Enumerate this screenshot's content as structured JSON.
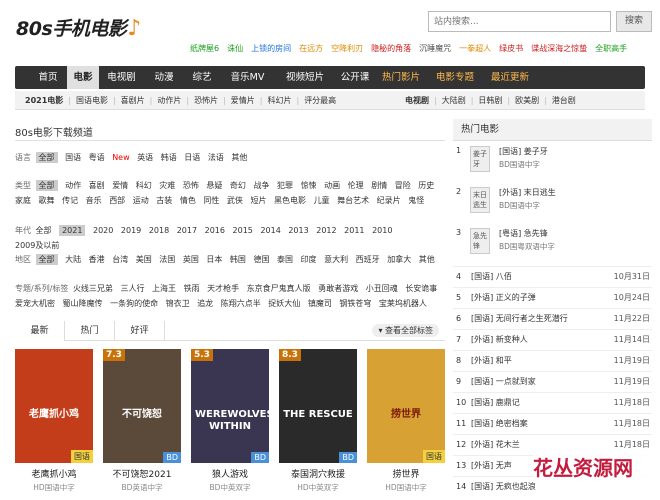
{
  "logo": {
    "text": "80s手机电影",
    "note": "♪"
  },
  "search": {
    "placeholder": "站内搜索...",
    "button": "搜索"
  },
  "hotlinks": [
    {
      "label": "纸牌屋6",
      "color": "#1a9e1a"
    },
    {
      "label": "诛仙",
      "color": "#1a9e1a"
    },
    {
      "label": "上锁的房间",
      "color": "#1a6fe0"
    },
    {
      "label": "在远方",
      "color": "#e08a00"
    },
    {
      "label": "空降利刃",
      "color": "#e08a00"
    },
    {
      "label": "隐秘的角落",
      "color": "#cc1a1a"
    },
    {
      "label": "沉睡魔咒",
      "color": "#555555"
    },
    {
      "label": "一拳超人",
      "color": "#e08a00"
    },
    {
      "label": "绿皮书",
      "color": "#cc1a1a"
    },
    {
      "label": "谍战深海之惊蛰",
      "color": "#cc1a1a"
    },
    {
      "label": "全职高手",
      "color": "#1a9e1a"
    }
  ],
  "nav": [
    {
      "label": "首页"
    },
    {
      "label": "电影",
      "active": true
    },
    {
      "label": "电视剧"
    },
    {
      "label": "动漫"
    },
    {
      "label": "综艺"
    },
    {
      "label": "音乐MV"
    },
    {
      "label": "视频短片"
    },
    {
      "label": "公开课"
    },
    {
      "label": "热门影片",
      "hot": true
    },
    {
      "label": "电影专题",
      "hot": true
    },
    {
      "label": "最近更新",
      "hot": true
    }
  ],
  "subnav_left": [
    "2021电影",
    "国语电影",
    "喜剧片",
    "动作片",
    "恐怖片",
    "爱情片",
    "科幻片",
    "评分最高"
  ],
  "subnav_right": [
    "电视剧",
    "大陆剧",
    "日韩剧",
    "欧美剧",
    "港台剧"
  ],
  "section_title": "80s电影下载频道",
  "filters": {
    "language": {
      "label": "语言",
      "options": [
        "全部",
        "国语",
        "粤语",
        "New",
        "英语",
        "韩语",
        "日语",
        "法语",
        "其他"
      ]
    },
    "genre": {
      "label": "类型",
      "options": [
        "全部",
        "动作",
        "喜剧",
        "爱情",
        "科幻",
        "灾难",
        "恐怖",
        "悬疑",
        "奇幻",
        "战争",
        "犯罪",
        "惊悚",
        "动画",
        "伦理",
        "剧情",
        "冒险",
        "历史",
        "家庭",
        "歌舞",
        "传记",
        "音乐",
        "西部",
        "运动",
        "古装",
        "情色",
        "同性",
        "武侠",
        "短片",
        "黑色电影",
        "儿童",
        "舞台艺术",
        "纪录片",
        "鬼怪"
      ]
    },
    "year": {
      "label": "年代",
      "options": [
        "全部",
        "2021",
        "2020",
        "2019",
        "2018",
        "2017",
        "2016",
        "2015",
        "2014",
        "2013",
        "2012",
        "2011",
        "2010",
        "2009及以前"
      ]
    },
    "region": {
      "label": "地区",
      "options": [
        "全部",
        "大陆",
        "香港",
        "台湾",
        "美国",
        "法国",
        "英国",
        "日本",
        "韩国",
        "德国",
        "泰国",
        "印度",
        "意大利",
        "西班牙",
        "加拿大",
        "其他"
      ]
    },
    "series": {
      "label": "专题/系列/标签",
      "options": [
        "火线三兄弟",
        "三人行",
        "上海王",
        "铁雨",
        "天才枪手",
        "东京食尸鬼真人版",
        "勇敢者游戏",
        "小丑回魂",
        "长安诡事",
        "爱宠大机密",
        "蜀山降魔传",
        "一条狗的使命",
        "锦衣卫",
        "追龙",
        "陈翔六点半",
        "捉妖大仙",
        "镇魔司",
        "钢铁苍穹",
        "宝莱坞机器人"
      ]
    }
  },
  "tabs": [
    "最新",
    "热门",
    "好评"
  ],
  "show_all": "查看全部标签",
  "movies": [
    {
      "title": "老鹰抓小鸡",
      "sub": "HD国语中字",
      "score": "",
      "badge": "国语",
      "badge_type": "guoyu",
      "poster_text": "老鹰抓小鸡",
      "bg": "#c43d1a"
    },
    {
      "title": "不可饶恕2021",
      "sub": "BD英语中字",
      "score": "7.3",
      "badge": "BD",
      "badge_type": "bd",
      "poster_text": "不可饶恕",
      "bg": "#5b4a3a"
    },
    {
      "title": "狼人游戏",
      "sub": "BD中英双字",
      "score": "5.3",
      "badge": "BD",
      "badge_type": "bd",
      "poster_text": "WEREWOLVES WITHIN",
      "bg": "#3a3550"
    },
    {
      "title": "泰国洞穴救援",
      "sub": "HD中英双字",
      "score": "8.3",
      "badge": "BD",
      "badge_type": "bd",
      "poster_text": "THE RESCUE",
      "bg": "#2a2a2a"
    },
    {
      "title": "捞世界",
      "sub": "HD国语中字",
      "score": "",
      "badge": "国语",
      "badge_type": "guoyu",
      "poster_text": "捞世界",
      "bg": "#d7a233"
    }
  ],
  "sidebar": {
    "title": "热门电影",
    "top3": [
      {
        "num": "1",
        "thumb": "姜子牙",
        "title": "[国语] 姜子牙",
        "sub": "BD国语中字"
      },
      {
        "num": "2",
        "thumb": "末日逃生",
        "title": "[外语] 末日逃生",
        "sub": "BD国语中字"
      },
      {
        "num": "3",
        "thumb": "急先锋",
        "title": "[粤语] 急先锋",
        "sub": "BD国粤双语中字"
      }
    ],
    "ranks": [
      {
        "num": "4",
        "title": "[国语] 八佰",
        "date": "10月31日"
      },
      {
        "num": "5",
        "title": "[外语] 正义的子弹",
        "date": "10月24日"
      },
      {
        "num": "6",
        "title": "[国语] 无间行者之生死潜行",
        "date": "11月22日"
      },
      {
        "num": "7",
        "title": "[外语] 新变种人",
        "date": "11月14日"
      },
      {
        "num": "8",
        "title": "[外语] 和平",
        "date": "11月19日"
      },
      {
        "num": "9",
        "title": "[国语] 一点就到家",
        "date": "11月19日"
      },
      {
        "num": "10",
        "title": "[国语] 鹿鼎记",
        "date": "11月18日"
      },
      {
        "num": "11",
        "title": "[国语] 绝密档案",
        "date": "11月18日"
      },
      {
        "num": "12",
        "title": "[外语] 花木兰",
        "date": "11月18日"
      },
      {
        "num": "13",
        "title": "[外语] 无声",
        "date": ""
      },
      {
        "num": "14",
        "title": "[国语] 无疯也起浪",
        "date": ""
      }
    ]
  },
  "watermark": {
    "cn": "花丛资源网",
    "en": ""
  }
}
